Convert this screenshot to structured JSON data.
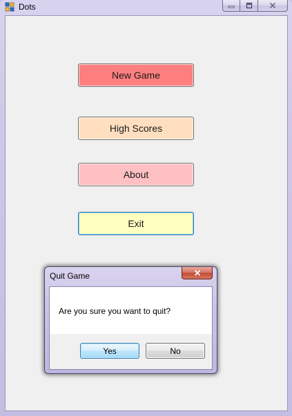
{
  "window": {
    "title": "Dots",
    "icon": "app-grid-icon"
  },
  "menu": {
    "new_game": "New Game",
    "high_scores": "High Scores",
    "about": "About",
    "exit": "Exit"
  },
  "dialog": {
    "title": "Quit Game",
    "message": "Are you sure you want to quit?",
    "yes": "Yes",
    "no": "No"
  },
  "colors": {
    "new_game_bg": "#ff7f7f",
    "high_scores_bg": "#ffdfc0",
    "about_bg": "#ffc0c4",
    "exit_bg": "#ffffc0",
    "client_bg": "#f0f0f0"
  }
}
